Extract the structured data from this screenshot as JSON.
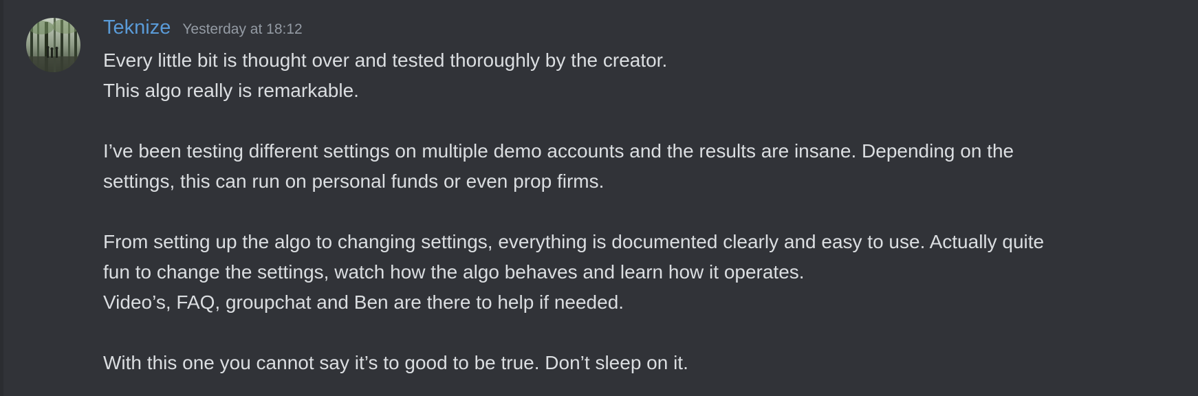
{
  "message": {
    "author": "Teknize",
    "timestamp": "Yesterday at 18:12",
    "avatar_icon": "user-avatar-forest",
    "colors": {
      "background": "#313338",
      "username": "#5a9bd8",
      "timestamp": "#949ba4",
      "text": "#dbdee1"
    },
    "lines": [
      "Every little bit is thought over and tested thoroughly by the creator.",
      "This algo really is remarkable.",
      "I’ve been testing different settings on multiple demo accounts and the results are insane. Depending on the",
      "settings, this can run on personal funds or even prop firms.",
      "From setting up the algo to changing settings, everything is documented clearly and easy to use. Actually quite",
      "fun to change the settings, watch how the algo behaves and learn how it operates.",
      "Video’s, FAQ, groupchat and Ben are there to help if needed.",
      "With this one you cannot say it’s to good to be true. Don’t sleep on it."
    ]
  }
}
